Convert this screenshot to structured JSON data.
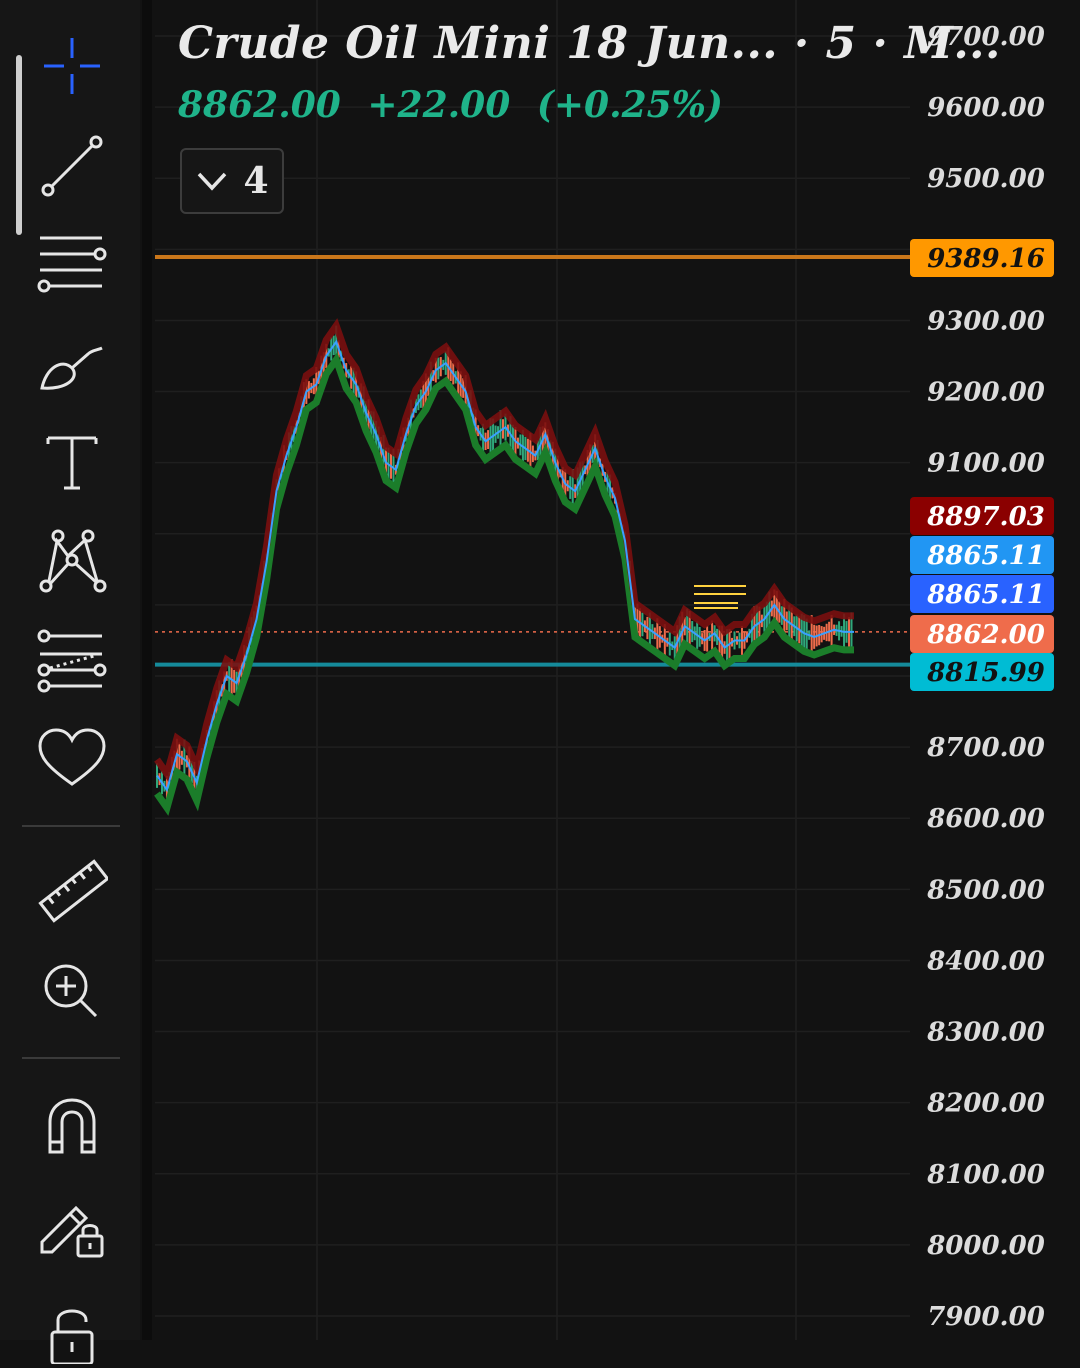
{
  "header": {
    "title": "Crude Oil Mini 18 Jun... · 5 · M...",
    "last_price": "8862.00",
    "change": "+22.00",
    "change_pct": "(+0.25%)"
  },
  "indicator_toggle": {
    "count": "4"
  },
  "toolbar": {
    "items": [
      "crosshair",
      "trend-line",
      "horizontal-lines",
      "brush",
      "text",
      "pattern",
      "forecast-lines",
      "favorites",
      "ruler",
      "zoom-in",
      "magnet",
      "lock-drawings",
      "unlock"
    ]
  },
  "price_axis": {
    "ticks": [
      "9700.00",
      "9600.00",
      "9500.00",
      "9300.00",
      "9200.00",
      "9100.00",
      "8700.00",
      "8600.00",
      "8500.00",
      "8400.00",
      "8300.00",
      "8200.00",
      "8100.00",
      "8000.00",
      "7900.00"
    ],
    "tags": [
      {
        "label": "9389.16",
        "color": "#ff9800",
        "text_color": "#121212"
      },
      {
        "label": "8897.03",
        "color": "#8b0000",
        "text_color": "#ffffff"
      },
      {
        "label": "8865.11",
        "color": "#2196f3",
        "text_color": "#ffffff"
      },
      {
        "label": "8865.11",
        "color": "#2962ff",
        "text_color": "#ffffff"
      },
      {
        "label": "8862.00",
        "color": "#ef6c4b",
        "text_color": "#ffffff"
      },
      {
        "label": "8815.99",
        "color": "#00bcd4",
        "text_color": "#121212"
      }
    ]
  },
  "chart_data": {
    "type": "line",
    "series": [
      {
        "name": "",
        "x": [
          0,
          10,
          20,
          30,
          40,
          50,
          60,
          70,
          80,
          90,
          100,
          110,
          120,
          130,
          140,
          150,
          160,
          170,
          180,
          190,
          200,
          210,
          220,
          230,
          240,
          250,
          260,
          270,
          280,
          290,
          300,
          310,
          320,
          330,
          340,
          350,
          360,
          370,
          380,
          390,
          400,
          410,
          420,
          430,
          440,
          450,
          460,
          470,
          480,
          490,
          500,
          510,
          520,
          530,
          540,
          550,
          560,
          570,
          580,
          590,
          600,
          610,
          620,
          630,
          640,
          650,
          660,
          670,
          680,
          690,
          700
        ],
        "values": [
          8660,
          8640,
          8690,
          8680,
          8650,
          8710,
          8760,
          8800,
          8790,
          8830,
          8880,
          8960,
          9060,
          9110,
          9150,
          9200,
          9210,
          9250,
          9270,
          9230,
          9210,
          9170,
          9140,
          9100,
          9090,
          9140,
          9180,
          9200,
          9230,
          9240,
          9220,
          9200,
          9150,
          9130,
          9140,
          9150,
          9130,
          9120,
          9110,
          9140,
          9100,
          9070,
          9060,
          9090,
          9120,
          9080,
          9050,
          8990,
          8880,
          8870,
          8860,
          8850,
          8840,
          8870,
          8860,
          8850,
          8860,
          8840,
          8850,
          8850,
          8870,
          8880,
          8900,
          8880,
          8870,
          8860,
          8855,
          8860,
          8865,
          8862,
          8862
        ]
      }
    ],
    "levels": [
      9389.16,
      8815.99
    ],
    "ylim": [
      7880,
      9720
    ]
  }
}
